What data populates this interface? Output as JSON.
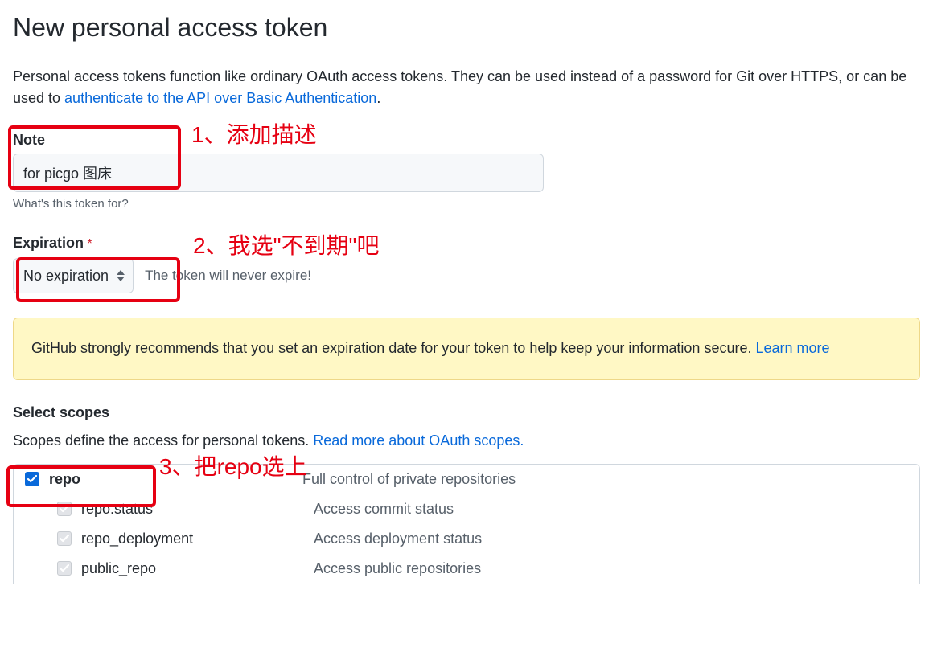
{
  "page_title": "New personal access token",
  "intro": {
    "text_before": "Personal access tokens function like ordinary OAuth access tokens. They can be used instead of a password for Git over HTTPS, or can be used to ",
    "link_text": "authenticate to the API over Basic Authentication",
    "text_after": "."
  },
  "note": {
    "label": "Note",
    "value": "for picgo 图床",
    "hint": "What's this token for?"
  },
  "expiration": {
    "label": "Expiration",
    "required_mark": "*",
    "selected": "No expiration",
    "help": "The token will never expire!"
  },
  "warning": {
    "text_before": "GitHub strongly recommends that you set an expiration date for your token to help keep your information secure. ",
    "link_text": "Learn more"
  },
  "scopes": {
    "title": "Select scopes",
    "desc_before": "Scopes define the access for personal tokens. ",
    "desc_link": "Read more about OAuth scopes.",
    "items": [
      {
        "name": "repo",
        "desc": "Full control of private repositories",
        "checked": true,
        "parent": true
      },
      {
        "name": "repo:status",
        "desc": "Access commit status",
        "checked": false,
        "parent": false
      },
      {
        "name": "repo_deployment",
        "desc": "Access deployment status",
        "checked": false,
        "parent": false
      },
      {
        "name": "public_repo",
        "desc": "Access public repositories",
        "checked": false,
        "parent": false
      }
    ]
  },
  "annotations": {
    "a1": "1、添加描述",
    "a2": "2、我选\"不到期\"吧",
    "a3": "3、把repo选上"
  }
}
